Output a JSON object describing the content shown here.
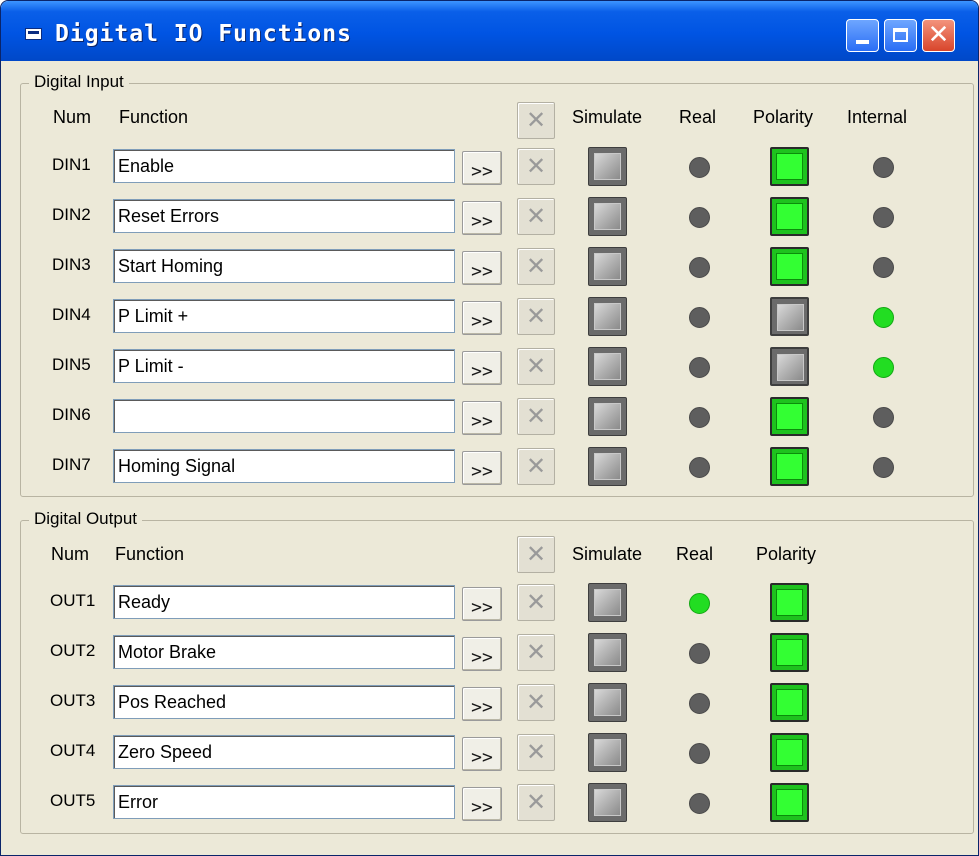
{
  "window": {
    "title": "Digital IO Functions",
    "controls": [
      "minimize",
      "maximize",
      "close"
    ]
  },
  "digital_input": {
    "group_label": "Digital Input",
    "headers": {
      "num": "Num",
      "function": "Function",
      "simulate": "Simulate",
      "real": "Real",
      "polarity": "Polarity",
      "internal": "Internal"
    },
    "rows": [
      {
        "num": "DIN1",
        "function": "Enable",
        "button": ">>",
        "real": "off",
        "polarity": "on",
        "internal": "off"
      },
      {
        "num": "DIN2",
        "function": "Reset Errors",
        "button": ">>",
        "real": "off",
        "polarity": "on",
        "internal": "off"
      },
      {
        "num": "DIN3",
        "function": "Start Homing",
        "button": ">>",
        "real": "off",
        "polarity": "on",
        "internal": "off"
      },
      {
        "num": "DIN4",
        "function": "P Limit +",
        "button": ">>",
        "real": "off",
        "polarity": "off",
        "internal": "on"
      },
      {
        "num": "DIN5",
        "function": "P Limit -",
        "button": ">>",
        "real": "off",
        "polarity": "off",
        "internal": "on"
      },
      {
        "num": "DIN6",
        "function": "",
        "button": ">>",
        "real": "off",
        "polarity": "on",
        "internal": "off"
      },
      {
        "num": "DIN7",
        "function": "Homing Signal",
        "button": ">>",
        "real": "off",
        "polarity": "on",
        "internal": "off"
      }
    ]
  },
  "digital_output": {
    "group_label": "Digital Output",
    "headers": {
      "num": "Num",
      "function": "Function",
      "simulate": "Simulate",
      "real": "Real",
      "polarity": "Polarity"
    },
    "rows": [
      {
        "num": "OUT1",
        "function": "Ready",
        "button": ">>",
        "real": "on",
        "polarity": "on"
      },
      {
        "num": "OUT2",
        "function": "Motor Brake",
        "button": ">>",
        "real": "off",
        "polarity": "on"
      },
      {
        "num": "OUT3",
        "function": "Pos Reached",
        "button": ">>",
        "real": "off",
        "polarity": "on"
      },
      {
        "num": "OUT4",
        "function": "Zero Speed",
        "button": ">>",
        "real": "off",
        "polarity": "on"
      },
      {
        "num": "OUT5",
        "function": "Error",
        "button": ">>",
        "real": "off",
        "polarity": "on"
      }
    ]
  },
  "colors": {
    "titlebar": "#0054e3",
    "led_on": "#22dd22",
    "led_off": "#5e5e5e",
    "polarity_on": "#33ff33"
  }
}
